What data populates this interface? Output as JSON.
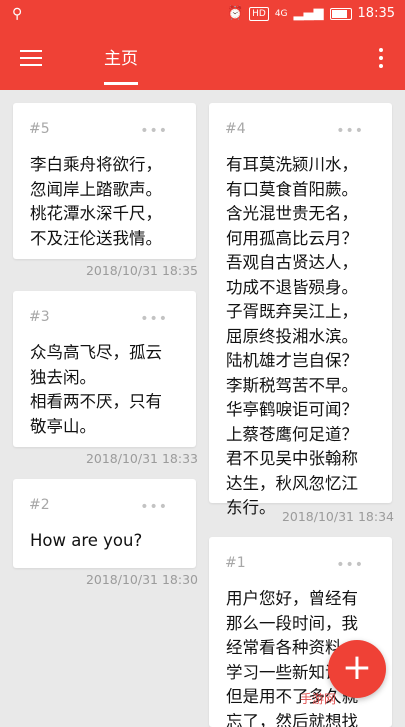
{
  "status": {
    "time": "18:35",
    "hd": "HD",
    "net": "4G"
  },
  "toolbar": {
    "tab_label": "主页"
  },
  "notes": [
    {
      "id": "#5",
      "text": "李白乘舟将欲行，\n忽闻岸上踏歌声。\n桃花潭水深千尺，\n不及汪伦送我情。",
      "timestamp": "2018/10/31 18:35"
    },
    {
      "id": "#3",
      "text": "众鸟高飞尽，孤云\n独去闲。\n相看两不厌，只有\n敬亭山。",
      "timestamp": "2018/10/31 18:33"
    },
    {
      "id": "#2",
      "text": "How are you?",
      "timestamp": "2018/10/31 18:30"
    },
    {
      "id": "#4",
      "text": "有耳莫洗颍川水，\n有口莫食首阳蕨。\n含光混世贵无名，\n何用孤高比云月？\n吾观自古贤达人，\n功成不退皆殒身。\n子胥既弃吴江上，\n屈原终投湘水滨。\n陆机雄才岂自保？\n李斯税驾苦不早。\n华亭鹤唳讵可闻？\n上蔡苍鹰何足道？\n君不见吴中张翰称\n达生，秋风忽忆江\n东行。",
      "timestamp": "2018/10/31 18:34"
    },
    {
      "id": "#1",
      "text": "用户您好，曾经有\n那么一段时间，我\n经常看各种资料，\n学习一些新知识，\n但是用不了多久就\n忘了，然后就想找",
      "timestamp": ""
    }
  ],
  "fab": {
    "label": "+"
  },
  "watermark": {
    "text": "手游网"
  },
  "colors": {
    "accent": "#ef4136",
    "background": "#e9e9e9"
  }
}
